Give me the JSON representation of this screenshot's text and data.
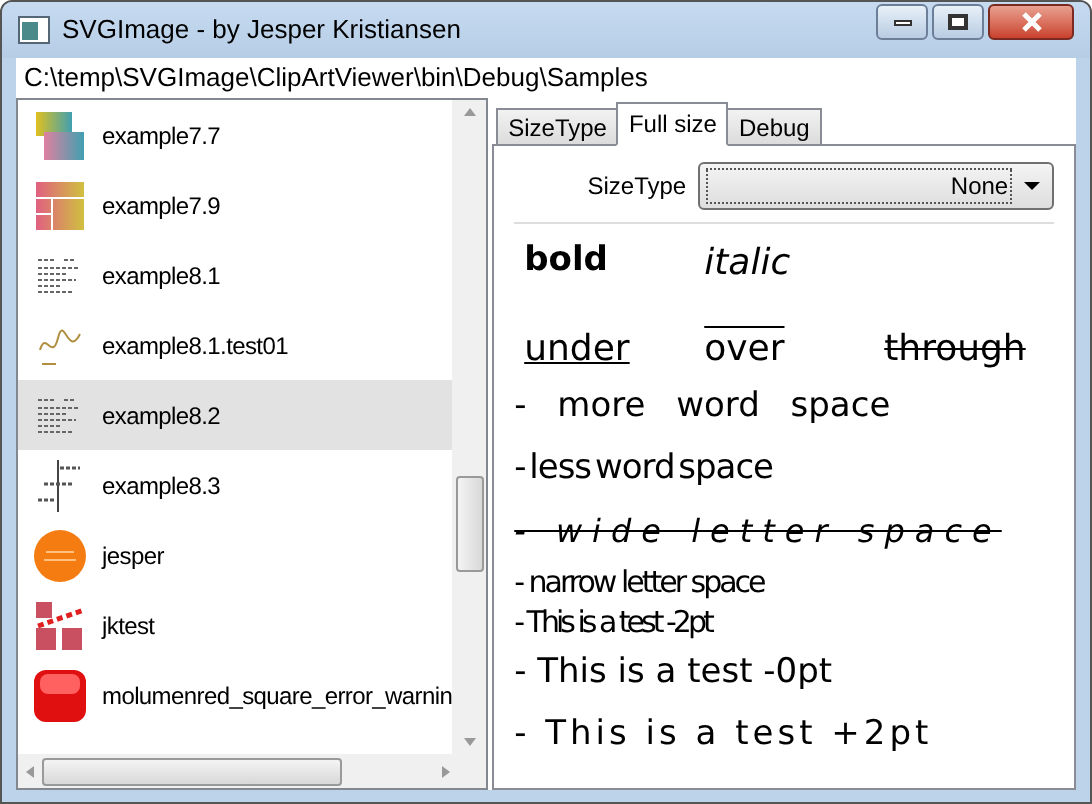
{
  "window": {
    "title": "SVGImage - by Jesper Kristiansen"
  },
  "path_bar": {
    "value": "C:\\temp\\SVGImage\\ClipArtViewer\\bin\\Debug\\Samples"
  },
  "file_list": {
    "items": [
      {
        "label": "example7.7",
        "kind": "gradient",
        "selected": false
      },
      {
        "label": "example7.9",
        "kind": "grid",
        "selected": false
      },
      {
        "label": "example8.1",
        "kind": "text",
        "selected": false
      },
      {
        "label": "example8.1.test01",
        "kind": "sketch",
        "selected": false
      },
      {
        "label": "example8.2",
        "kind": "text",
        "selected": true
      },
      {
        "label": "example8.3",
        "kind": "anchors",
        "selected": false
      },
      {
        "label": "jesper",
        "kind": "circle",
        "selected": false
      },
      {
        "label": "jktest",
        "kind": "blocks",
        "selected": false
      },
      {
        "label": "molumenred_square_error_warnin",
        "kind": "square",
        "selected": false
      }
    ]
  },
  "tabs": [
    {
      "label": "SizeType",
      "selected": false
    },
    {
      "label": "Full size",
      "selected": true
    },
    {
      "label": "Debug",
      "selected": false
    }
  ],
  "size_type": {
    "label": "SizeType",
    "value": "None"
  },
  "preview": {
    "rows": [
      {
        "items": [
          {
            "text": "bold",
            "kind": "bold"
          },
          {
            "text": "italic",
            "kind": "italic"
          }
        ]
      },
      {
        "items": [
          {
            "text": "under",
            "kind": "underline"
          },
          {
            "text": "over",
            "kind": "overline"
          },
          {
            "text": "through",
            "kind": "strikethrough"
          }
        ]
      },
      {
        "items": [
          {
            "text": "- more word space",
            "kind": "widewords"
          }
        ]
      },
      {
        "items": [
          {
            "text": "- less word space",
            "kind": "narrowwords"
          }
        ]
      },
      {
        "items": [
          {
            "text": "- wide letter space",
            "kind": "wideletters"
          }
        ]
      },
      {
        "items": [
          {
            "text": "- narrow letter space",
            "kind": "narrowletters"
          }
        ]
      },
      {
        "items": [
          {
            "text": "- This is a test -2pt",
            "kind": "condensed"
          }
        ]
      },
      {
        "items": [
          {
            "text": "- This is a test -0pt",
            "kind": "normal"
          }
        ]
      },
      {
        "items": [
          {
            "text": "- This is a test +2pt",
            "kind": "expanded"
          }
        ]
      }
    ]
  }
}
